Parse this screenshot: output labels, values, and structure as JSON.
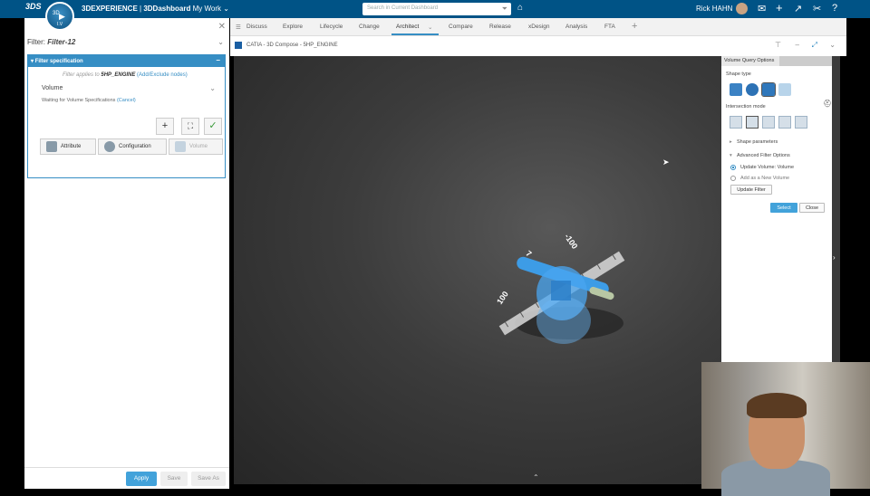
{
  "topbar": {
    "logo_text": "3DS",
    "compass": {
      "label": "3D",
      "bottom": "I.V"
    },
    "brand_bold": "3DEXPERIENCE",
    "brand_sep": " | ",
    "brand_app": "3DDashboard",
    "brand_context": "My Work",
    "search_placeholder": "Search in Current Dashboard",
    "user_name": "Rick HAHN",
    "icons": [
      "filter-icon",
      "tag-icon",
      "share-icon",
      "add-icon",
      "forward-icon",
      "tools-icon",
      "help-icon"
    ]
  },
  "left_panel": {
    "filter_label": "Filter:",
    "filter_name": "Filter-12",
    "spec_header": "Filter specification",
    "applies_prefix": "Filter applies to",
    "applies_node": "5HP_ENGINE",
    "applies_link": "(Add/Exclude nodes)",
    "volume_label": "Volume",
    "waiting_text": "Waiting for Volume Specifications",
    "cancel_link": "(Cancel)",
    "type_buttons": {
      "attribute": "Attribute",
      "configuration": "Configuration",
      "volume": "Volume"
    },
    "apply": "Apply",
    "save": "Save",
    "save_as": "Save As"
  },
  "tabs": [
    {
      "label": "Discuss"
    },
    {
      "label": "Explore"
    },
    {
      "label": "Lifecycle"
    },
    {
      "label": "Change"
    },
    {
      "label": "Architect"
    },
    {
      "label": "Compare"
    },
    {
      "label": "Release"
    },
    {
      "label": "xDesign"
    },
    {
      "label": "Analysis"
    },
    {
      "label": "FTA"
    }
  ],
  "viewer": {
    "title": "CATIA - 3D Compose - 5HP_ENGINE",
    "ruler_labels": [
      "-100",
      "7",
      "100"
    ]
  },
  "vqo": {
    "tab": "Volume Query Options",
    "shape_type": "Shape type",
    "intersection_mode": "Intersection mode",
    "shape_params": "Shape parameters",
    "advanced": "Advanced Filter Options",
    "update_volume": "Update Volume: Volume",
    "add_new": "Add as a New Volume",
    "update_filter": "Update Filter",
    "select": "Select",
    "close": "Close"
  }
}
